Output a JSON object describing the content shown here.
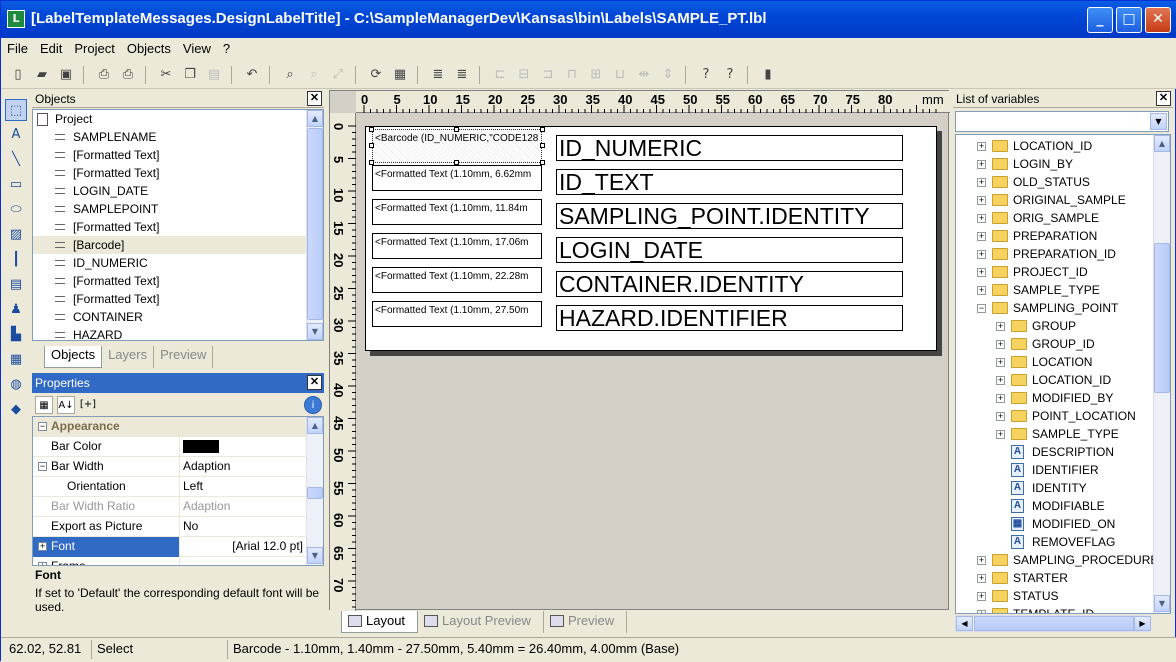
{
  "window": {
    "title": "[LabelTemplateMessages.DesignLabelTitle] - C:\\SampleManagerDev\\Kansas\\bin\\Labels\\SAMPLE_PT.lbl",
    "app_icon": "label-designer-icon",
    "controls": {
      "minimize": "_",
      "maximize": "□",
      "close": "✕"
    }
  },
  "menu": [
    "File",
    "Edit",
    "Project",
    "Objects",
    "View",
    "?"
  ],
  "toolbar_icons": [
    "new-icon",
    "open-icon",
    "save-icon",
    "print-icon",
    "print-preview-icon",
    "cut-icon",
    "copy-icon",
    "paste-icon",
    "undo-icon",
    "zoom-in-icon",
    "zoom-out-icon",
    "zoom-fit-icon",
    "refresh-icon",
    "properties-icon",
    "layer-front-icon",
    "layer-back-icon",
    "align-left-icon",
    "align-center-icon",
    "align-right-icon",
    "align-top-icon",
    "align-middle-icon",
    "align-bottom-icon",
    "space-horizontal-icon",
    "space-vertical-icon",
    "help-icon",
    "whats-this-icon",
    "bookmark-icon"
  ],
  "objects_panel": {
    "title": "Objects",
    "items": [
      {
        "label": "Project",
        "root": true,
        "selected": false
      },
      {
        "label": "SAMPLENAME",
        "selected": false
      },
      {
        "label": "[Formatted Text]",
        "selected": false
      },
      {
        "label": "[Formatted Text]",
        "selected": false
      },
      {
        "label": "LOGIN_DATE",
        "selected": false
      },
      {
        "label": "SAMPLEPOINT",
        "selected": false
      },
      {
        "label": "[Formatted Text]",
        "selected": false
      },
      {
        "label": "[Barcode]",
        "selected": true
      },
      {
        "label": "ID_NUMERIC",
        "selected": false
      },
      {
        "label": "[Formatted Text]",
        "selected": false
      },
      {
        "label": "[Formatted Text]",
        "selected": false
      },
      {
        "label": "CONTAINER",
        "selected": false
      },
      {
        "label": "HAZARD",
        "selected": false
      }
    ],
    "tabs": [
      "Objects",
      "Layers",
      "Preview"
    ],
    "active_tab": "Objects"
  },
  "properties_panel": {
    "title": "Properties",
    "tools": [
      "categorized-icon",
      "sort-az-icon",
      "expand-all-icon",
      "info-icon"
    ],
    "rows": [
      {
        "name": "Appearance",
        "value": "",
        "type": "category"
      },
      {
        "name": "Bar Color",
        "value": "",
        "type": "color",
        "color": "#000000"
      },
      {
        "name": "Bar Width",
        "value": "Adaption",
        "type": "expanded"
      },
      {
        "name": "Orientation",
        "value": "Left",
        "type": "child"
      },
      {
        "name": "Bar Width Ratio",
        "value": "Adaption",
        "type": "disabled"
      },
      {
        "name": "Export as Picture",
        "value": "No",
        "type": "normal"
      },
      {
        "name": "Font",
        "value": "[Arial 12.0 pt]",
        "type": "selected"
      },
      {
        "name": "Frame",
        "value": "",
        "type": "collapsed"
      }
    ],
    "description_title": "Font",
    "description_text": "If set to 'Default' the corresponding default font will be used."
  },
  "ruler": {
    "horizontal": [
      "0",
      "5",
      "10",
      "15",
      "20",
      "25",
      "30",
      "35",
      "40",
      "45",
      "50",
      "55",
      "60",
      "65",
      "70",
      "75",
      "80"
    ],
    "unit": "mm",
    "vertical": [
      "0",
      "5",
      "10",
      "15",
      "20",
      "25",
      "30",
      "35",
      "40",
      "45",
      "50",
      "55",
      "60",
      "65",
      "70"
    ]
  },
  "label_canvas": {
    "left_fields": [
      "<Barcode (ID_NUMERIC,\"CODE128",
      "<Formatted Text (1.10mm, 6.62mm",
      "<Formatted Text (1.10mm, 11.84m",
      "<Formatted Text (1.10mm, 17.06m",
      "<Formatted Text (1.10mm, 22.28m",
      "<Formatted Text (1.10mm, 27.50m"
    ],
    "right_fields": [
      "ID_NUMERIC",
      "ID_TEXT",
      "SAMPLING_POINT.IDENTITY",
      "LOGIN_DATE",
      "CONTAINER.IDENTITY",
      "HAZARD.IDENTIFIER"
    ]
  },
  "design_tabs": [
    "Layout",
    "Layout Preview",
    "Preview"
  ],
  "active_design_tab": "Layout",
  "variables_panel": {
    "title": "List of variables",
    "combo_value": "",
    "items": [
      {
        "label": "LOCATION_ID",
        "level": 0,
        "kind": "folder"
      },
      {
        "label": "LOGIN_BY",
        "level": 0,
        "kind": "folder"
      },
      {
        "label": "OLD_STATUS",
        "level": 0,
        "kind": "folder"
      },
      {
        "label": "ORIGINAL_SAMPLE",
        "level": 0,
        "kind": "folder"
      },
      {
        "label": "ORIG_SAMPLE",
        "level": 0,
        "kind": "folder"
      },
      {
        "label": "PREPARATION",
        "level": 0,
        "kind": "folder"
      },
      {
        "label": "PREPARATION_ID",
        "level": 0,
        "kind": "folder"
      },
      {
        "label": "PROJECT_ID",
        "level": 0,
        "kind": "folder"
      },
      {
        "label": "SAMPLE_TYPE",
        "level": 0,
        "kind": "folder"
      },
      {
        "label": "SAMPLING_POINT",
        "level": 0,
        "kind": "folder-open"
      },
      {
        "label": "GROUP",
        "level": 1,
        "kind": "folder"
      },
      {
        "label": "GROUP_ID",
        "level": 1,
        "kind": "folder"
      },
      {
        "label": "LOCATION",
        "level": 1,
        "kind": "folder"
      },
      {
        "label": "LOCATION_ID",
        "level": 1,
        "kind": "folder"
      },
      {
        "label": "MODIFIED_BY",
        "level": 1,
        "kind": "folder"
      },
      {
        "label": "POINT_LOCATION",
        "level": 1,
        "kind": "folder"
      },
      {
        "label": "SAMPLE_TYPE",
        "level": 1,
        "kind": "folder"
      },
      {
        "label": "DESCRIPTION",
        "level": 1,
        "kind": "field"
      },
      {
        "label": "IDENTIFIER",
        "level": 1,
        "kind": "field"
      },
      {
        "label": "IDENTITY",
        "level": 1,
        "kind": "field"
      },
      {
        "label": "MODIFIABLE",
        "level": 1,
        "kind": "field"
      },
      {
        "label": "MODIFIED_ON",
        "level": 1,
        "kind": "date-field"
      },
      {
        "label": "REMOVEFLAG",
        "level": 1,
        "kind": "field"
      },
      {
        "label": "SAMPLING_PROCEDURE",
        "level": 0,
        "kind": "folder"
      },
      {
        "label": "STARTER",
        "level": 0,
        "kind": "folder"
      },
      {
        "label": "STATUS",
        "level": 0,
        "kind": "folder"
      },
      {
        "label": "TEMPLATE_ID",
        "level": 0,
        "kind": "folder"
      }
    ]
  },
  "status_bar": {
    "coords": "62.02, 52.81",
    "mode": "Select",
    "info": "Barcode  -  1.10mm, 1.40mm  -  27.50mm, 5.40mm  =  26.40mm, 4.00mm (Base)"
  },
  "colors": {
    "titlebar": "#0047d6",
    "selection": "#316ac5",
    "chrome": "#ece9d8"
  }
}
